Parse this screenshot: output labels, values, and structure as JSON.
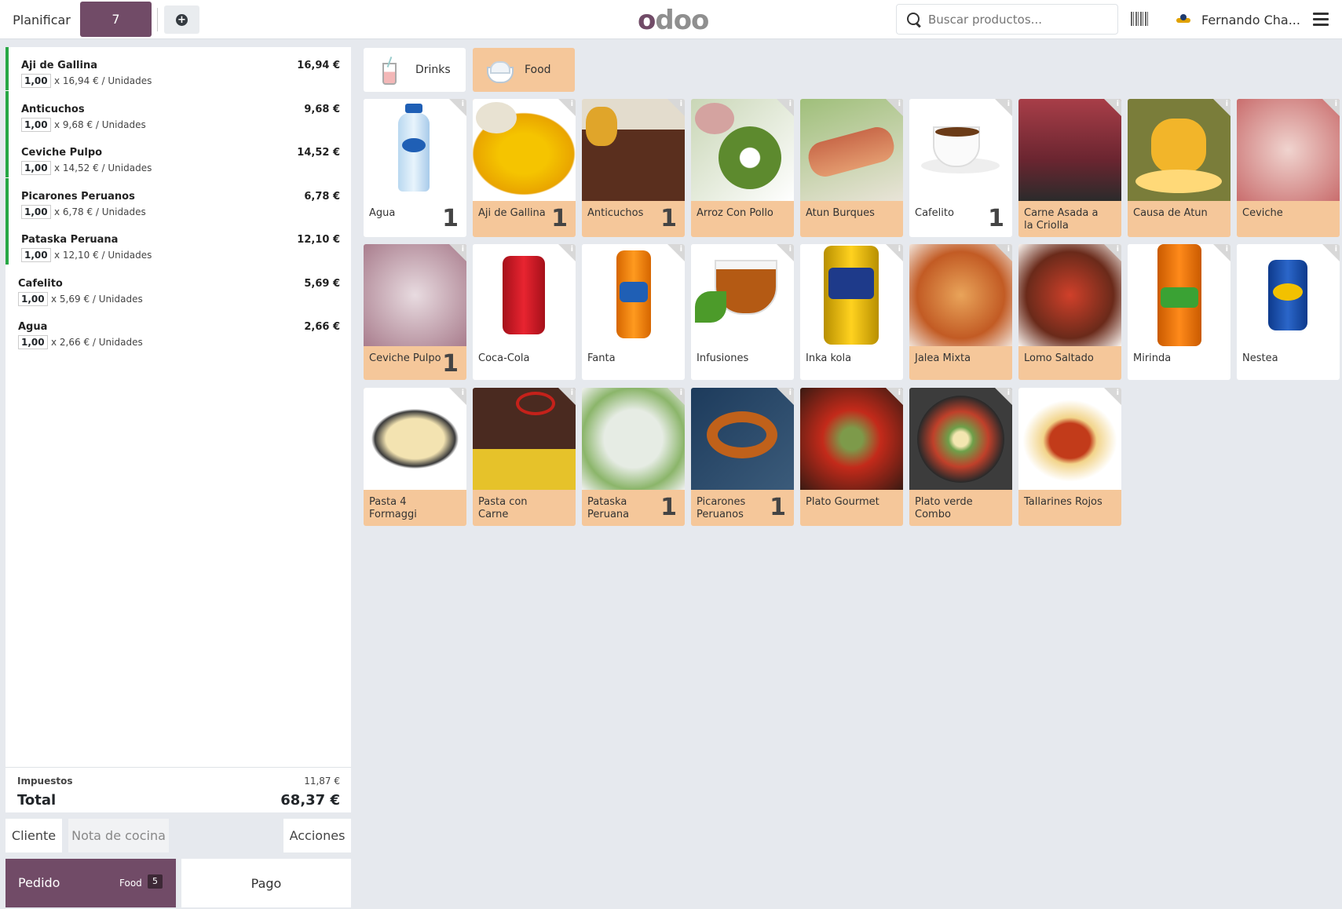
{
  "topbar": {
    "planificar": "Planificar",
    "table_number": "7",
    "add_icon": "+",
    "logo_o1": "o",
    "logo_d": "d",
    "logo_oo": "oo",
    "search_placeholder": "Buscar productos...",
    "user_name": "Fernando Cha..."
  },
  "categories": [
    {
      "label": "Drinks",
      "icon": "cup-icon",
      "selected": false
    },
    {
      "label": "Food",
      "icon": "bowl-icon",
      "selected": true
    }
  ],
  "order": {
    "lines": [
      {
        "name": "Aji de Gallina",
        "price": "16,94 €",
        "qty": "1,00",
        "unit": "x 16,94 € / Unidades",
        "sent": true
      },
      {
        "name": "Anticuchos",
        "price": "9,68 €",
        "qty": "1,00",
        "unit": "x 9,68 € / Unidades",
        "sent": true
      },
      {
        "name": "Ceviche Pulpo",
        "price": "14,52 €",
        "qty": "1,00",
        "unit": "x 14,52 € / Unidades",
        "sent": true
      },
      {
        "name": "Picarones Peruanos",
        "price": "6,78 €",
        "qty": "1,00",
        "unit": "x 6,78 € / Unidades",
        "sent": true
      },
      {
        "name": "Pataska Peruana",
        "price": "12,10 €",
        "qty": "1,00",
        "unit": "x 12,10 € / Unidades",
        "sent": true
      },
      {
        "name": "Cafelito",
        "price": "5,69 €",
        "qty": "1,00",
        "unit": "x 5,69 € / Unidades",
        "sent": false
      },
      {
        "name": "Agua",
        "price": "2,66 €",
        "qty": "1,00",
        "unit": "x 2,66 € / Unidades",
        "sent": false
      }
    ],
    "taxes_label": "Impuestos",
    "taxes_value": "11,87 €",
    "total_label": "Total",
    "total_value": "68,37 €"
  },
  "actions": {
    "cliente": "Cliente",
    "nota": "Nota de cocina",
    "acciones": "Acciones",
    "pedido": "Pedido",
    "pedido_category": "Food",
    "pedido_count": "5",
    "pago": "Pago"
  },
  "products": [
    {
      "name": "Agua",
      "qty": "1",
      "food": false,
      "img": "water-bottle"
    },
    {
      "name": "Aji de Gallina",
      "qty": "1",
      "food": true,
      "img": "yellow-stew"
    },
    {
      "name": "Anticuchos",
      "qty": "1",
      "food": true,
      "img": "grilled-meat"
    },
    {
      "name": "Arroz Con Pollo",
      "qty": "",
      "food": true,
      "img": "green-rice"
    },
    {
      "name": "Atun Burques",
      "qty": "",
      "food": true,
      "img": "tuna"
    },
    {
      "name": "Cafelito",
      "qty": "1",
      "food": false,
      "img": "coffee-cup"
    },
    {
      "name": "Carne Asada a la Criolla",
      "qty": "",
      "food": true,
      "img": "red-meat"
    },
    {
      "name": "Causa de Atun",
      "qty": "",
      "food": true,
      "img": "causa"
    },
    {
      "name": "Ceviche",
      "qty": "",
      "food": true,
      "img": "ceviche"
    },
    {
      "name": "Ceviche Pulpo",
      "qty": "1",
      "food": true,
      "img": "ceviche-pulpo"
    },
    {
      "name": "Coca-Cola",
      "qty": "",
      "food": false,
      "img": "coke-can"
    },
    {
      "name": "Fanta",
      "qty": "",
      "food": false,
      "img": "fanta-can"
    },
    {
      "name": "Infusiones",
      "qty": "",
      "food": false,
      "img": "tea-cup"
    },
    {
      "name": "Inka kola",
      "qty": "",
      "food": false,
      "img": "inka-can"
    },
    {
      "name": "Jalea Mixta",
      "qty": "",
      "food": true,
      "img": "jalea"
    },
    {
      "name": "Lomo Saltado",
      "qty": "",
      "food": true,
      "img": "lomo"
    },
    {
      "name": "Mirinda",
      "qty": "",
      "food": false,
      "img": "mirinda-can"
    },
    {
      "name": "Nestea",
      "qty": "",
      "food": false,
      "img": "nestea-can"
    },
    {
      "name": "Pasta 4 Formaggi",
      "qty": "",
      "food": true,
      "img": "pasta-cheese"
    },
    {
      "name": "Pasta con Carne",
      "qty": "",
      "food": true,
      "img": "pasta-meat"
    },
    {
      "name": "Pataska Peruana",
      "qty": "1",
      "food": true,
      "img": "soup"
    },
    {
      "name": "Picarones Peruanos",
      "qty": "1",
      "food": true,
      "img": "picarones"
    },
    {
      "name": "Plato Gourmet",
      "qty": "",
      "food": true,
      "img": "gourmet"
    },
    {
      "name": "Plato verde Combo",
      "qty": "",
      "food": true,
      "img": "green-plate"
    },
    {
      "name": "Tallarines Rojos",
      "qty": "",
      "food": true,
      "img": "red-pasta"
    }
  ],
  "colors": {
    "brand": "#714b67",
    "food_tile": "#f5c79a",
    "sent_indicator": "#28a745"
  }
}
